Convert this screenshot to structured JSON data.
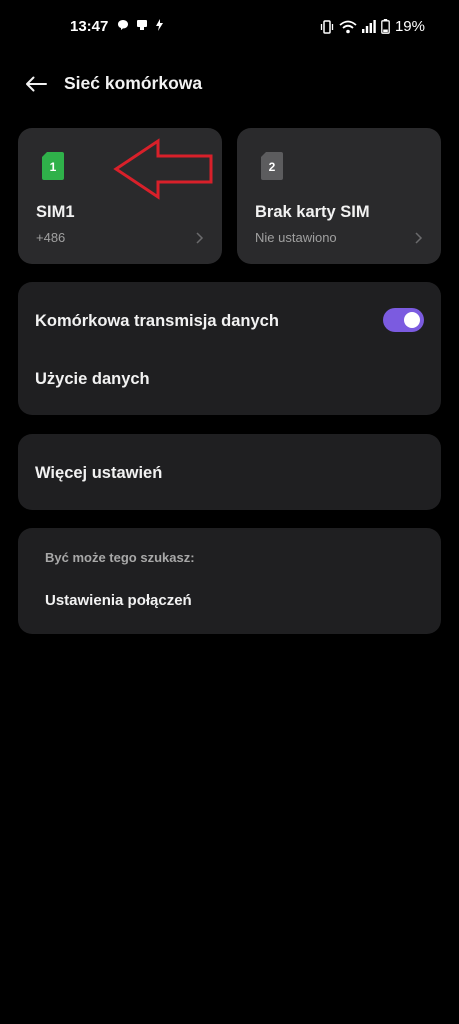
{
  "status_bar": {
    "time": "13:47",
    "battery": "19%",
    "left_icons": [
      "chat-bubble-icon",
      "notification-icon",
      "flash-icon"
    ],
    "right_icons": [
      "vibrate-icon",
      "wifi-icon",
      "signal-icon",
      "battery-icon"
    ]
  },
  "header": {
    "title": "Sieć komórkowa"
  },
  "sim_cards": [
    {
      "badge": "1",
      "title": "SIM1",
      "subtitle": "+486",
      "color": "#2fb14a"
    },
    {
      "badge": "2",
      "title": "Brak karty SIM",
      "subtitle": "Nie ustawiono",
      "color": "#5c5c5e"
    }
  ],
  "mobile_data": {
    "toggle_label": "Komórkowa transmisja danych",
    "toggle_on": true,
    "usage_label": "Użycie danych",
    "accent": "#7b5be0"
  },
  "more_settings": {
    "label": "Więcej ustawień"
  },
  "suggestions": {
    "caption": "Być może tego szukasz:",
    "link": "Ustawienia połączeń"
  },
  "annotation": {
    "color": "#d8202a"
  }
}
